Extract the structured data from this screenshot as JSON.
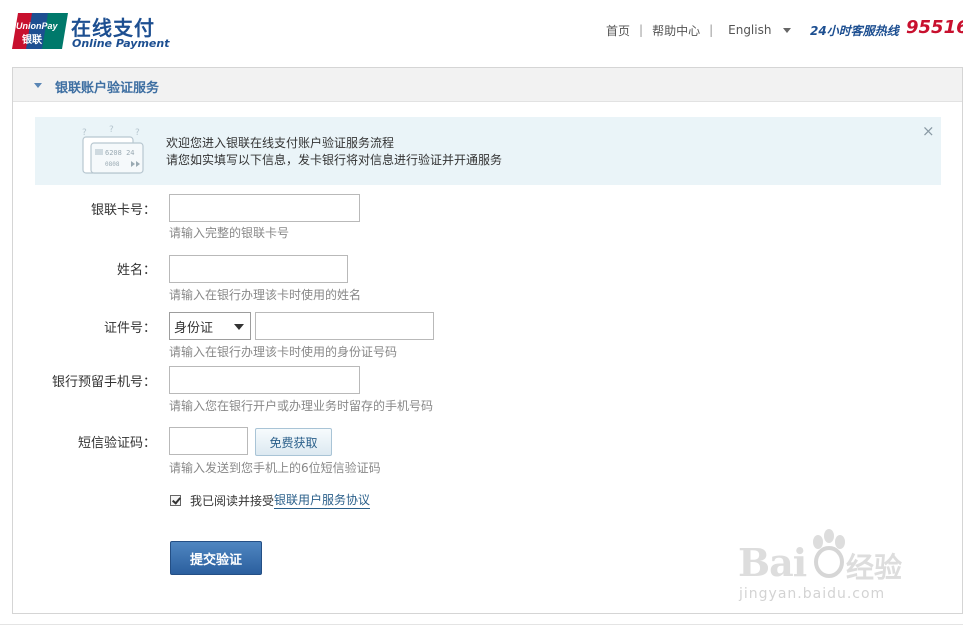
{
  "header": {
    "logo_unionpay": "UnionPay",
    "logo_yinlian": "银联",
    "title_cn": "在线支付",
    "title_en": "Online Payment",
    "nav": {
      "home": "首页",
      "help": "帮助中心",
      "language": "English",
      "separator": "|"
    },
    "hotline_label": "24小时客服热线",
    "hotline_number": "95516"
  },
  "panel": {
    "title": "银联账户验证服务",
    "notice": {
      "line1": "欢迎您进入银联在线支付账户验证服务流程",
      "line2": "请您如实填写以下信息，发卡银行将对信息进行验证并开通服务",
      "close": "×",
      "card_text1": "6208 24",
      "card_text2": "0808"
    },
    "form": {
      "card_label": "银联卡号：",
      "card_value": "",
      "card_hint": "请输入完整的银联卡号",
      "name_label": "姓名：",
      "name_value": "",
      "name_hint": "请输入在银行办理该卡时使用的姓名",
      "id_label": "证件号：",
      "id_type_selected": "身份证",
      "id_value": "",
      "id_hint": "请输入在银行办理该卡时使用的身份证号码",
      "phone_label": "银行预留手机号：",
      "phone_value": "",
      "phone_hint": "请输入您在银行开户或办理业务时留存的手机号码",
      "sms_label": "短信验证码：",
      "sms_value": "",
      "sms_button": "免费获取",
      "sms_hint": "请输入发送到您手机上的6位短信验证码",
      "agree_text": "我已阅读并接受",
      "agree_link": "银联用户服务协议",
      "agree_checked": true,
      "submit": "提交验证"
    }
  },
  "watermark": {
    "brand": "Bai",
    "brand_cn": "经验",
    "url": "jingyan.baidu.com"
  },
  "colors": {
    "brand_blue": "#1d4f91",
    "brand_red": "#c8102e",
    "accent": "#3e6fa2",
    "notice_bg": "#eaf4f8"
  }
}
